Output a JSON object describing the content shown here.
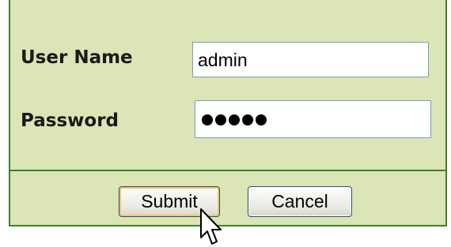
{
  "form": {
    "username_label": "User Name",
    "username_value": "admin",
    "password_label": "Password",
    "password_dot_count": 5,
    "submit_label": "Submit",
    "cancel_label": "Cancel"
  },
  "colors": {
    "panel_background": "#dbe5b5",
    "panel_border": "#417f2a",
    "input_border": "#7f9db9",
    "submit_focus_ring": "#f7c65c",
    "button_border": "#2a4c7a"
  },
  "icons": {
    "cursor": "mouse-pointer-icon"
  }
}
